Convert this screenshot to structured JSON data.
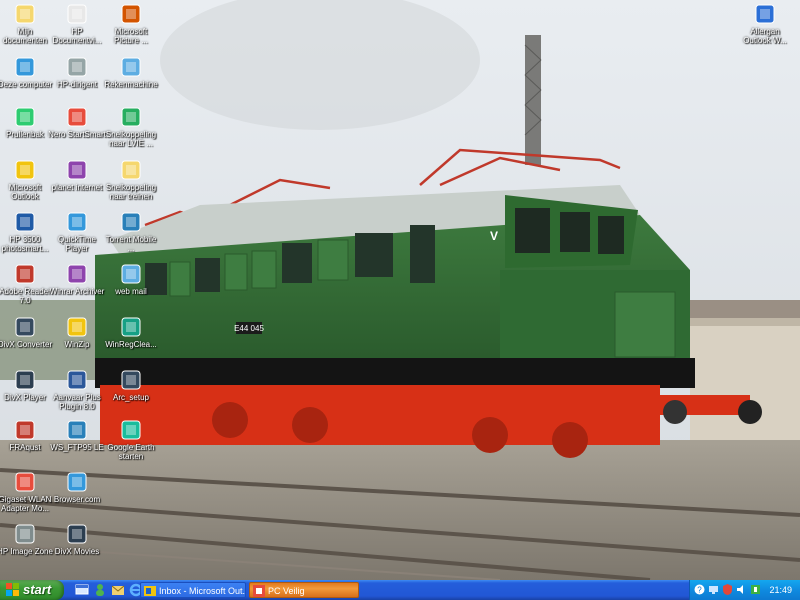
{
  "desktop": {
    "icons": [
      {
        "label": "Mijn documenten",
        "icon": "my-documents-icon"
      },
      {
        "label": "HP Documentvi...",
        "icon": "hp-document-viewer-icon"
      },
      {
        "label": "Microsoft Picture ...",
        "icon": "picture-manager-icon"
      },
      {
        "label": "Deze computer",
        "icon": "my-computer-icon"
      },
      {
        "label": "HP-dirigent",
        "icon": "hp-director-icon"
      },
      {
        "label": "Rekenmachine",
        "icon": "calculator-icon"
      },
      {
        "label": "Prullenbak",
        "icon": "recycle-bin-icon"
      },
      {
        "label": "Nero StartSmart",
        "icon": "nero-startsmart-icon"
      },
      {
        "label": "Snelkoppeling naar LVIE ...",
        "icon": "shortcut-lvie-icon"
      },
      {
        "label": "Microsoft Outlook",
        "icon": "outlook-icon"
      },
      {
        "label": "planet internet",
        "icon": "planet-internet-icon"
      },
      {
        "label": "Snelkoppeling naar treinen",
        "icon": "folder-treinen-icon"
      },
      {
        "label": "HP 3500 photosmart...",
        "icon": "hp-photosmart-icon"
      },
      {
        "label": "QuickTime Player",
        "icon": "quicktime-icon"
      },
      {
        "label": "Torrent Mobile ...",
        "icon": "torrent-icon"
      },
      {
        "label": "Adobe Reader 7.0",
        "icon": "adobe-reader-icon"
      },
      {
        "label": "Winrar Archiver",
        "icon": "winrar-icon"
      },
      {
        "label": "web mail",
        "icon": "web-mail-icon"
      },
      {
        "label": "DivX Converter",
        "icon": "divx-converter-icon"
      },
      {
        "label": "WinZip",
        "icon": "winzip-icon"
      },
      {
        "label": "WinRegClea...",
        "icon": "winregclean-icon"
      },
      {
        "label": "DivX Player",
        "icon": "divx-player-icon"
      },
      {
        "label": "Aanvaar Plus Plugin 8.0",
        "icon": "word-document-icon"
      },
      {
        "label": "Arc_setup",
        "icon": "setup-icon"
      },
      {
        "label": "FRAqust",
        "icon": "fraqust-icon"
      },
      {
        "label": "WS_FTP95 LE",
        "icon": "ws-ftp-icon"
      },
      {
        "label": "Google Earth starten",
        "icon": "google-earth-icon"
      },
      {
        "label": "Gigaset WLAN Adapter Mo...",
        "icon": "gigaset-wlan-icon"
      },
      {
        "label": "Browser.com",
        "icon": "browser-icon"
      },
      {
        "label": "HP Image Zone",
        "icon": "hp-image-zone-icon"
      },
      {
        "label": "DivX Movies",
        "icon": "divx-movies-icon"
      },
      {
        "label": "Allergan Outlook W...",
        "icon": "outlook-web-icon"
      }
    ]
  },
  "wallpaper": {
    "locomotive_number": "E44 045",
    "side_letter": "V"
  },
  "taskbar": {
    "start_label": "start",
    "quicklaunch": [
      "show-desktop-icon",
      "messenger-icon",
      "outlook-express-icon",
      "internet-explorer-icon"
    ],
    "tasks": [
      {
        "label": "Inbox - Microsoft Out...",
        "icon": "outlook-icon"
      },
      {
        "label": "PC Veilig",
        "icon": "pc-veilig-icon"
      }
    ],
    "clock": "21:49"
  },
  "colors": {
    "taskbar_blue": "#245edb",
    "start_green": "#3c9a35",
    "active_task_orange": "#e8891f",
    "tray_blue": "#0f8be0"
  }
}
